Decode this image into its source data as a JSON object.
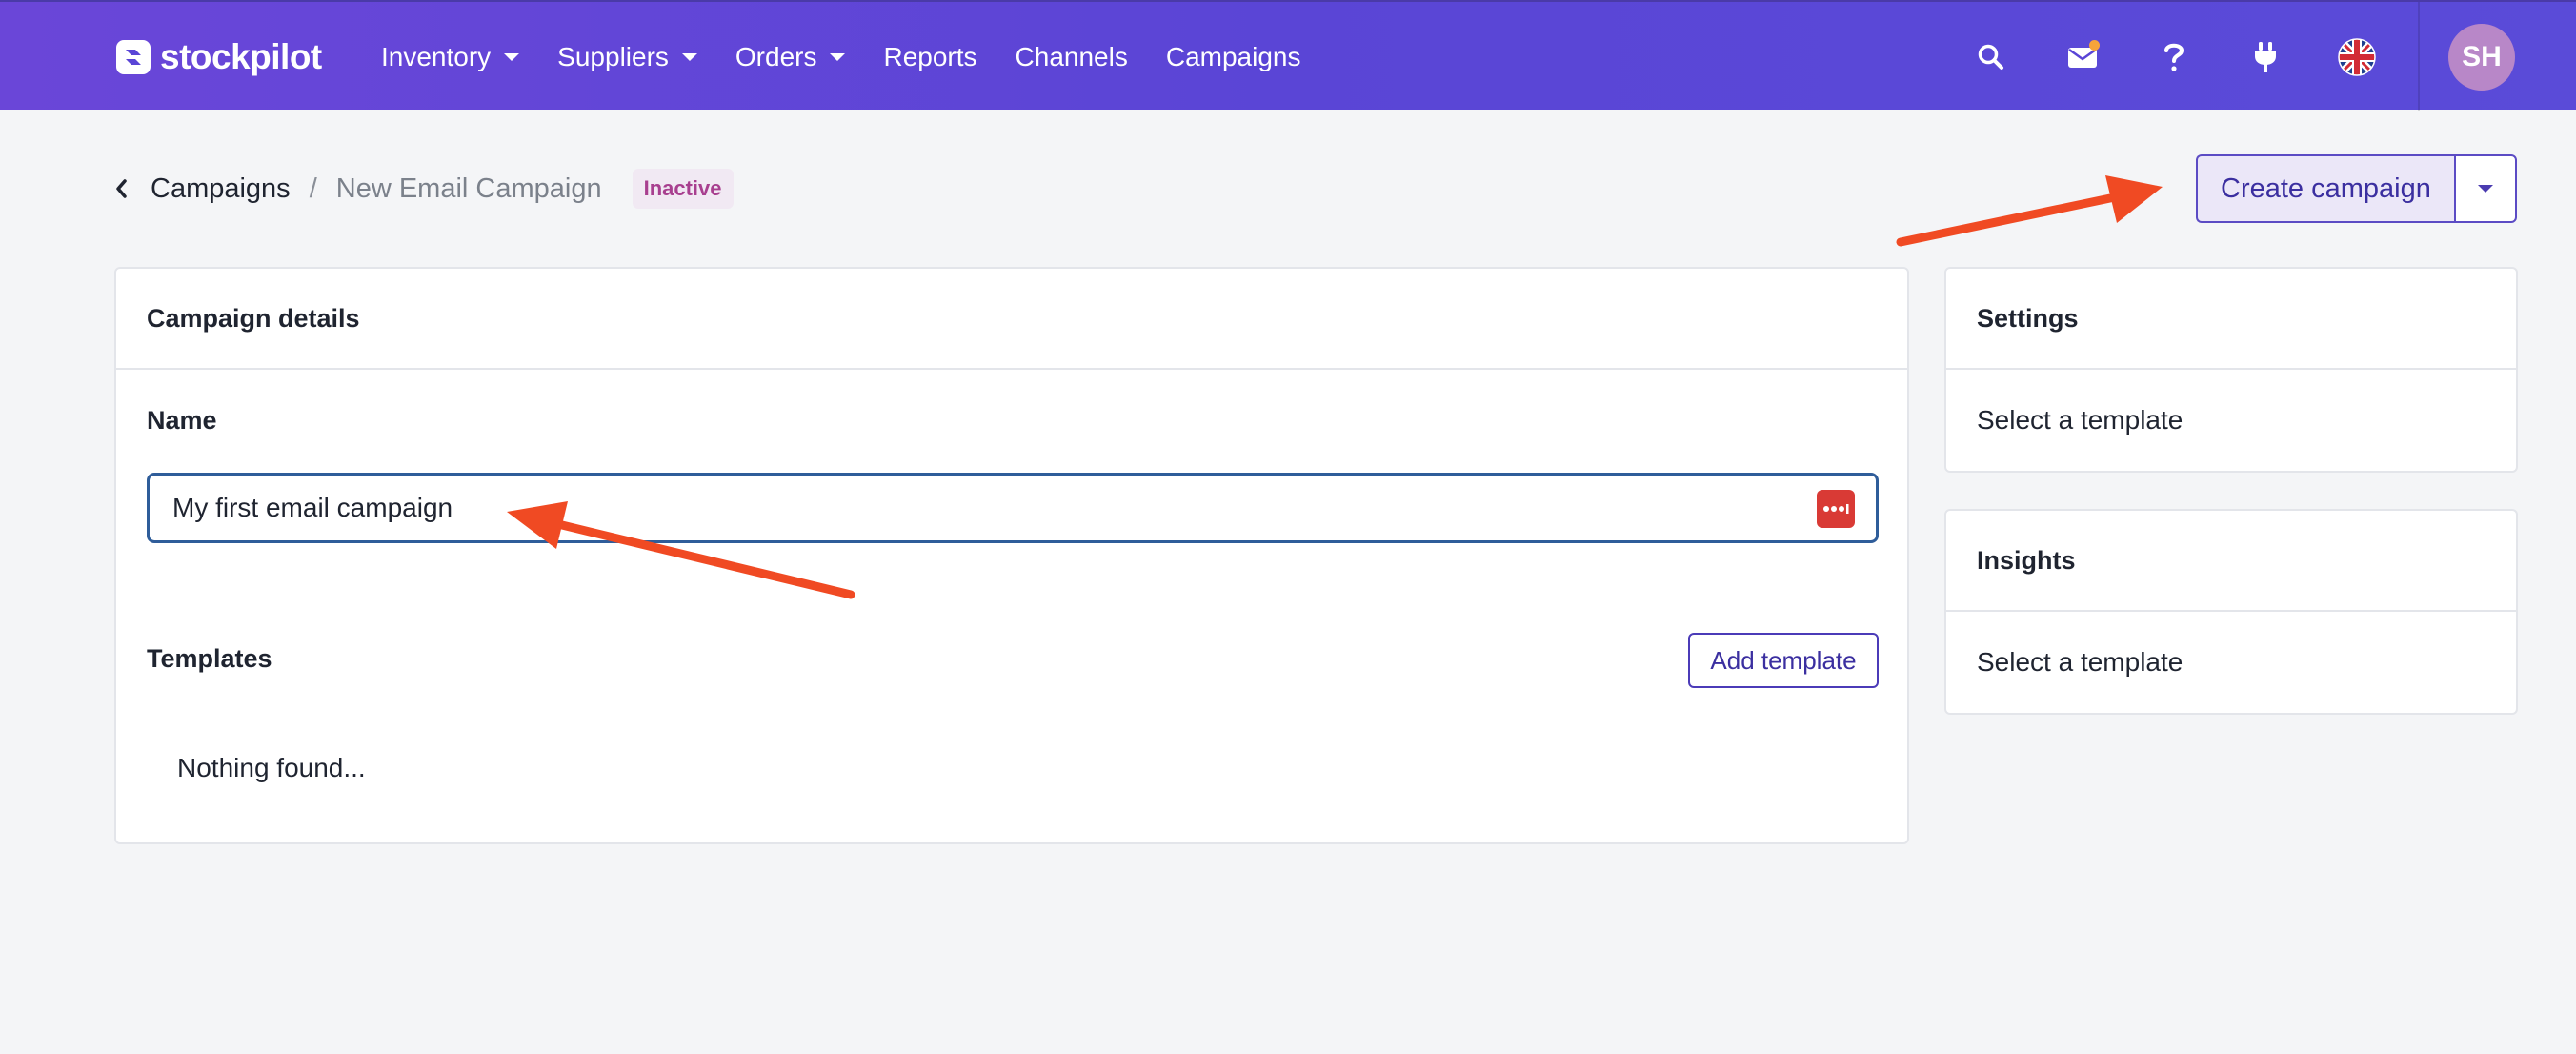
{
  "brand": {
    "name": "stockpilot"
  },
  "nav": {
    "items": [
      {
        "label": "Inventory",
        "dropdown": true
      },
      {
        "label": "Suppliers",
        "dropdown": true
      },
      {
        "label": "Orders",
        "dropdown": true
      },
      {
        "label": "Reports",
        "dropdown": false
      },
      {
        "label": "Channels",
        "dropdown": false
      },
      {
        "label": "Campaigns",
        "dropdown": false
      }
    ],
    "icons": [
      "search-icon",
      "mail-icon",
      "help-icon",
      "plug-icon",
      "uk-flag-icon"
    ],
    "user_initials": "SH"
  },
  "breadcrumb": {
    "parent": "Campaigns",
    "separator": "/",
    "current": "New Email Campaign",
    "status": "Inactive"
  },
  "actions": {
    "create_label": "Create campaign"
  },
  "details": {
    "title": "Campaign details",
    "name_label": "Name",
    "name_value": "My first email campaign",
    "templates_label": "Templates",
    "add_template_label": "Add template",
    "empty_text": "Nothing found..."
  },
  "settings": {
    "title": "Settings",
    "body": "Select a template"
  },
  "insights": {
    "title": "Insights",
    "body": "Select a template"
  },
  "colors": {
    "header": "#5a45d6",
    "accent": "#4b3bb8",
    "badge_text": "#a83f8f",
    "annotation_arrow": "#f04a23"
  }
}
